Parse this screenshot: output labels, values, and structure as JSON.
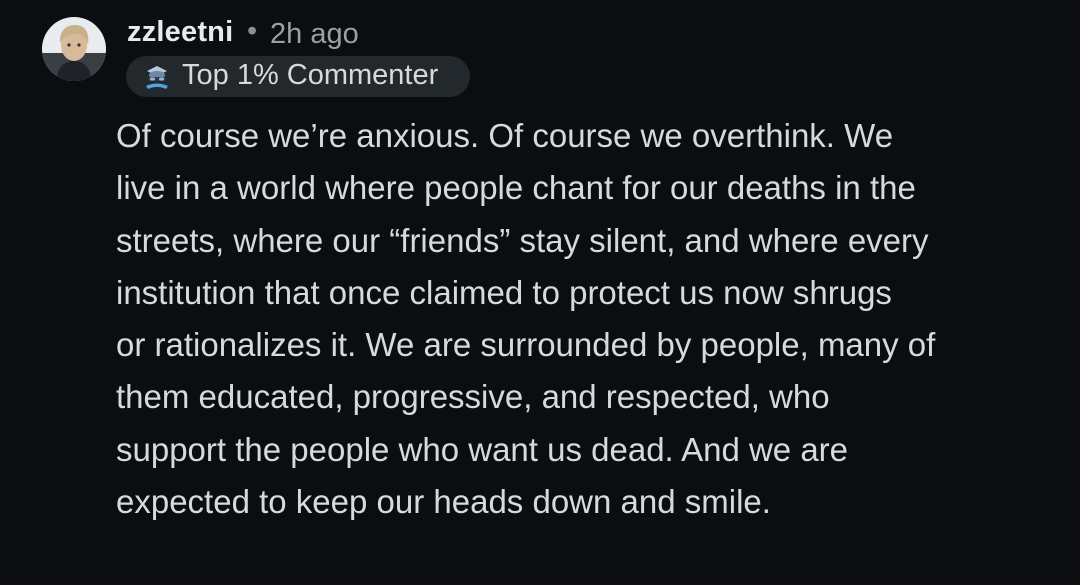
{
  "comment": {
    "author": "zzleetni",
    "separator": "•",
    "timestamp": "2h ago",
    "badge": {
      "label": "Top 1% Commenter",
      "icon": "top-commenter-icon"
    },
    "avatar_icon": "user-avatar",
    "paragraphs": [
      "Of course we’re anxious. Of course we overthink. We\nlive in a world where people chant for our deaths in the\nstreets, where our “friends” stay silent, and where every\ninstitution that once claimed to protect us now shrugs\nor rationalizes it. We are surrounded by people, many of\nthem educated, progressive, and respected, who\nsupport the people who want us dead. And we are\nexpected to keep our heads down and smile."
    ]
  },
  "colors": {
    "background": "#0b0d10",
    "text": "#d7dadc",
    "muted": "#9aa0a6",
    "badge_bg": "#23282d"
  }
}
